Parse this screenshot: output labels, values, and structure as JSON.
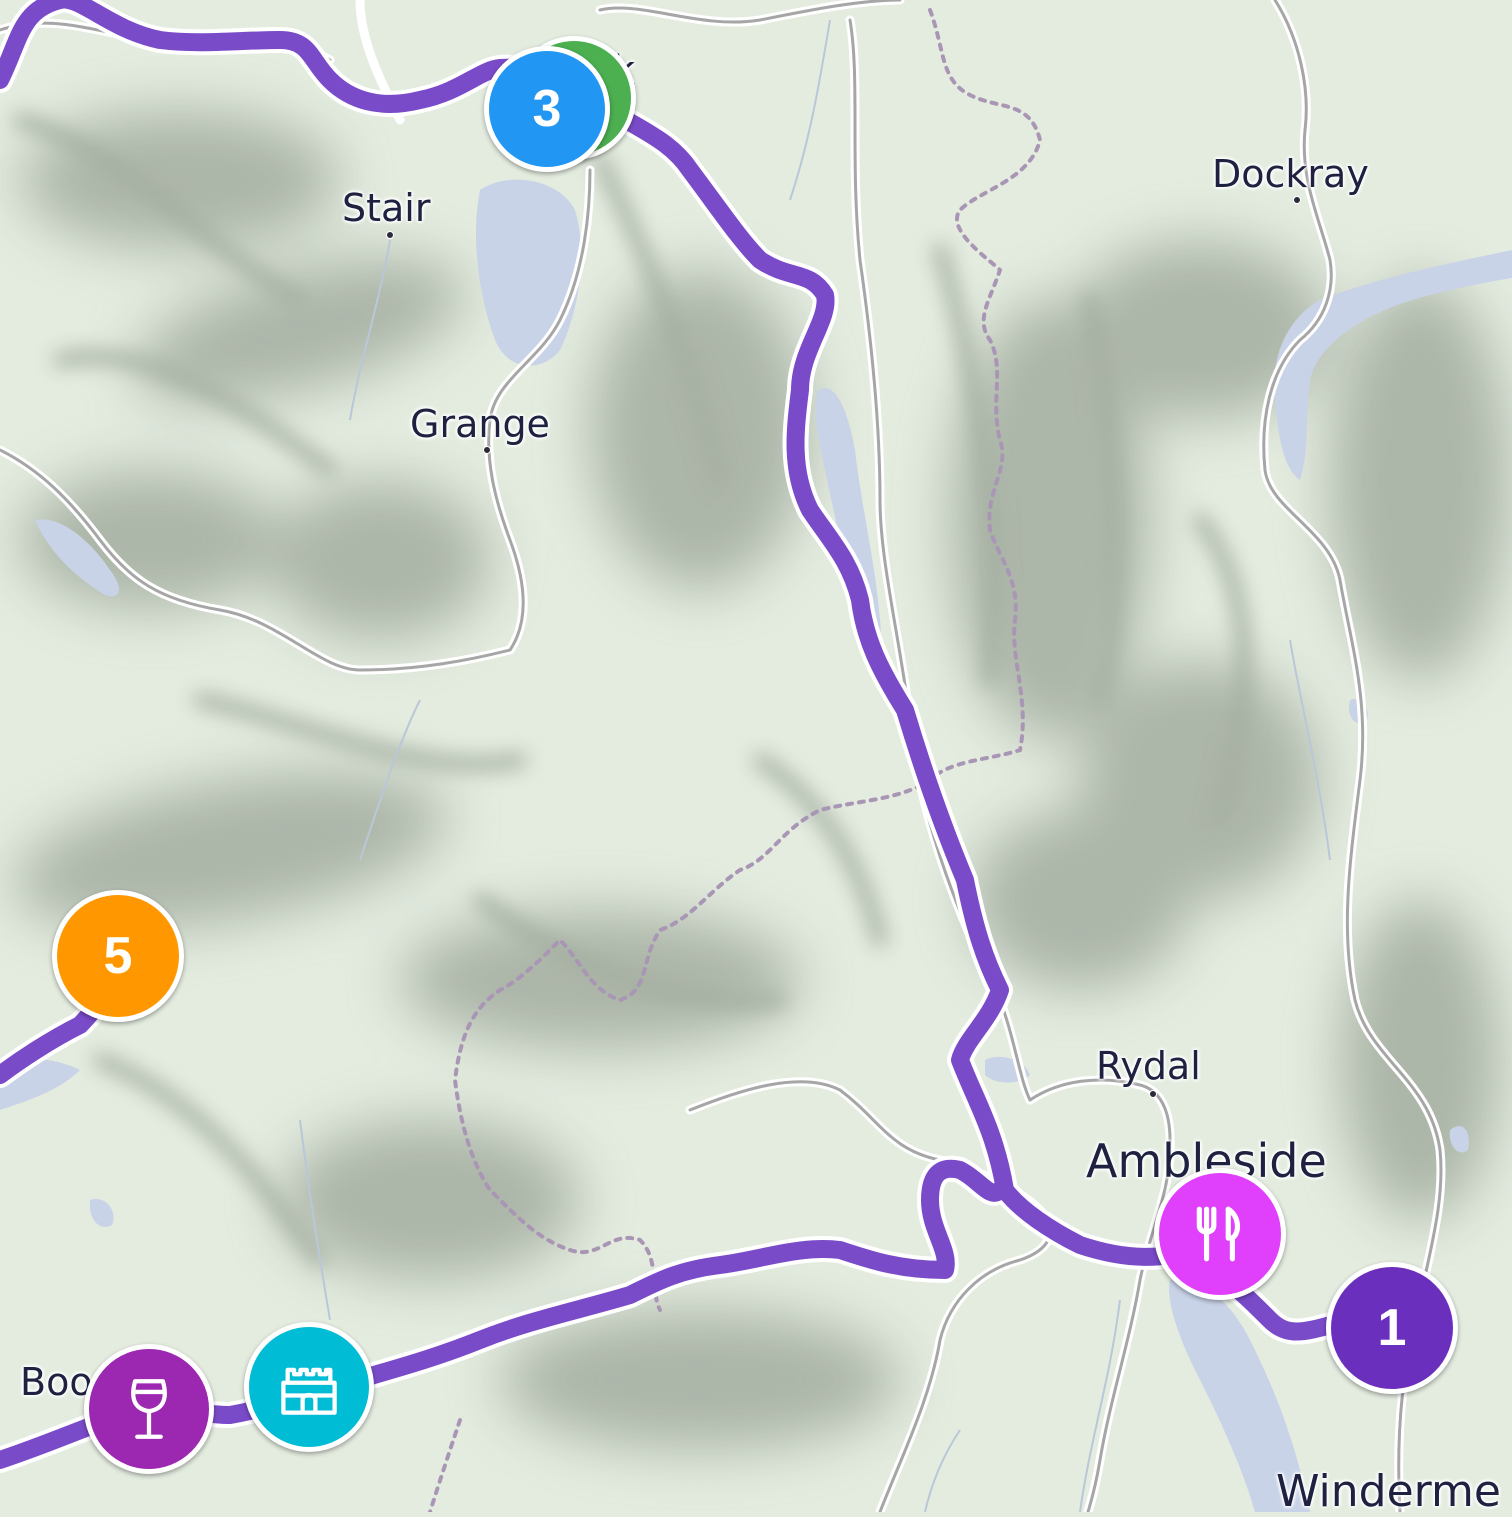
{
  "places": {
    "keswick": "k",
    "stair": "Stair",
    "grange": "Grange",
    "dockray": "Dockray",
    "rydal": "Rydal",
    "ambleside": "Ambleside",
    "boot": "Boo",
    "windermere": "Winderme"
  },
  "markers": {
    "stop_1": {
      "label": "1",
      "color": "#6a2fbd"
    },
    "stop_3": {
      "label": "3",
      "color": "#2196f3"
    },
    "stop_5": {
      "label": "5",
      "color": "#ff9800"
    },
    "stop_green": {
      "color": "#4caf50"
    },
    "restaurant": {
      "icon": "fork-knife-icon",
      "color": "#e040fb"
    },
    "castle": {
      "icon": "castle-icon",
      "color": "#00bcd4"
    },
    "winery": {
      "icon": "wine-glass-icon",
      "color": "#9c27b0"
    }
  },
  "colors": {
    "route": "#7a4bc9",
    "water": "#c9d3e8",
    "road": "#9b9b9b",
    "boundary": "#a996b5",
    "terrain_base": "#e4ece0"
  }
}
